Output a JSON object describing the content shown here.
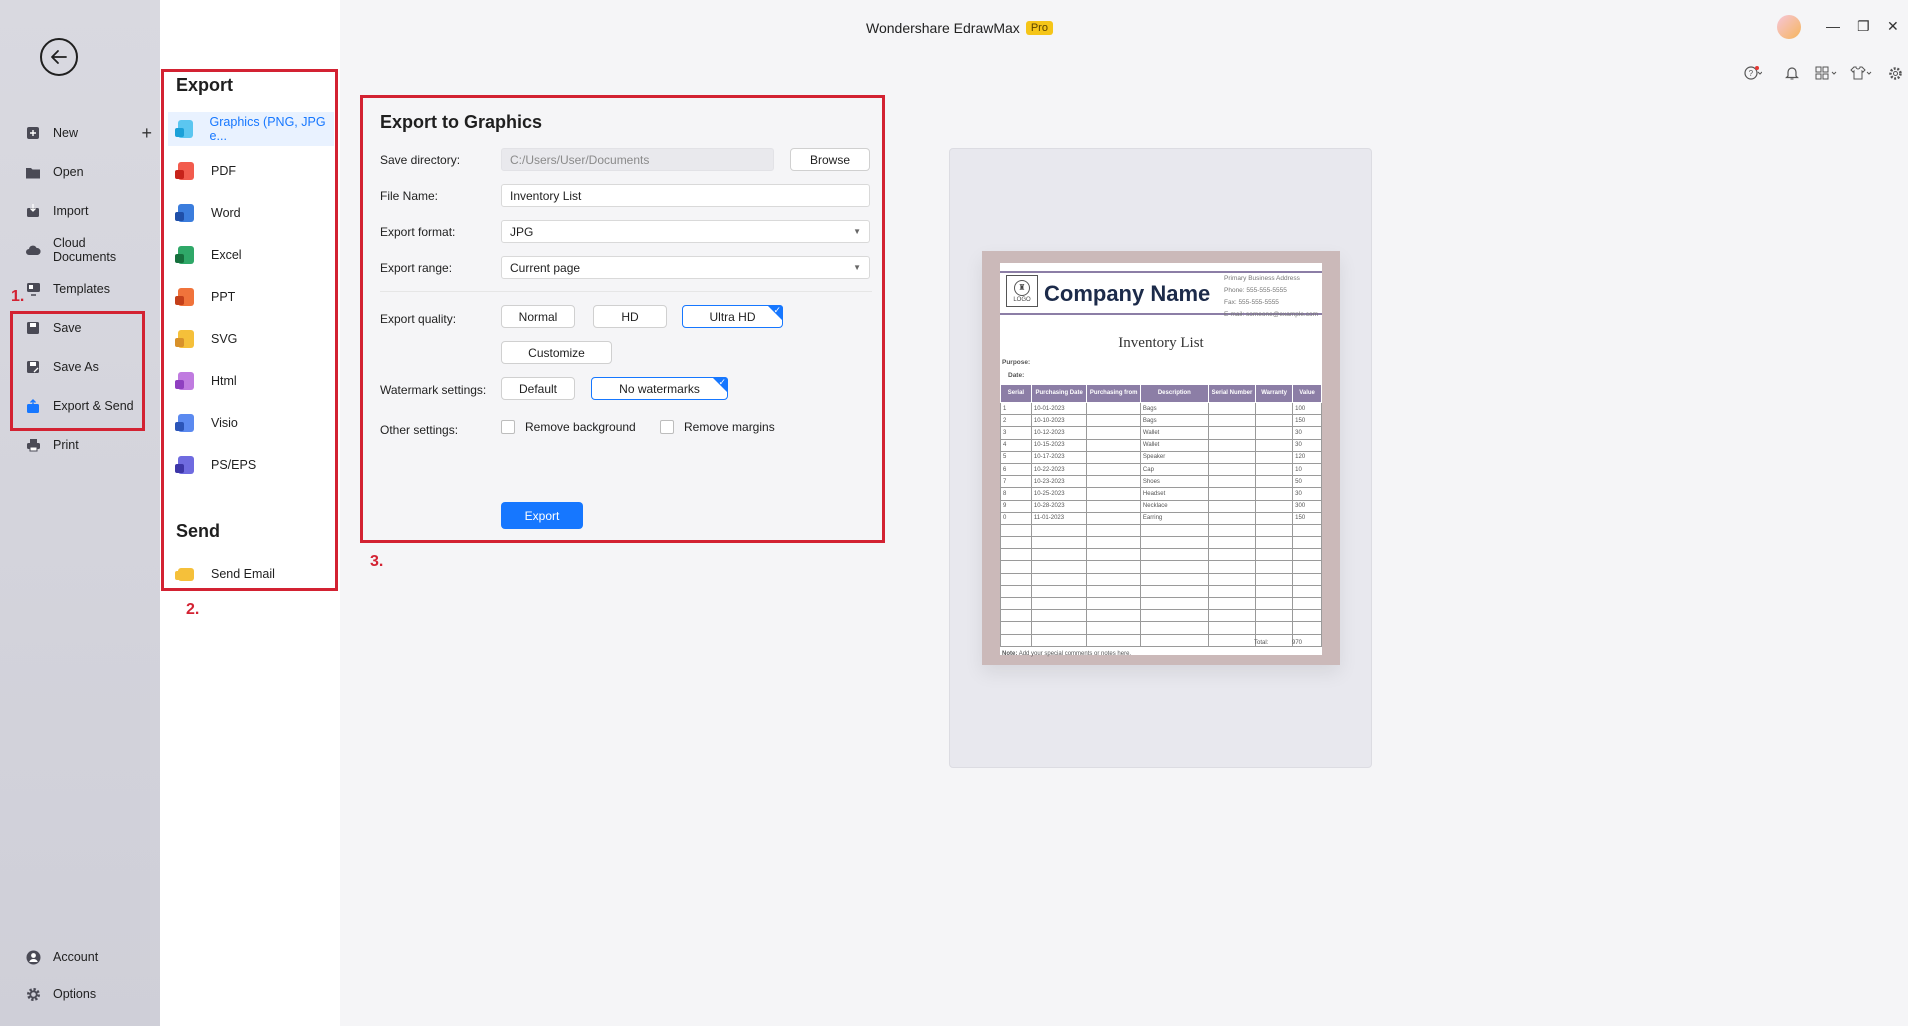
{
  "app": {
    "title": "Wondershare EdrawMax",
    "badge": "Pro"
  },
  "nav": {
    "items": [
      {
        "label": "New",
        "icon": "plus-square-icon",
        "has_plus": true
      },
      {
        "label": "Open",
        "icon": "folder-icon"
      },
      {
        "label": "Import",
        "icon": "import-icon"
      },
      {
        "label": "Cloud Documents",
        "icon": "cloud-icon"
      },
      {
        "label": "Templates",
        "icon": "templates-icon"
      },
      {
        "label": "Save",
        "icon": "save-icon"
      },
      {
        "label": "Save As",
        "icon": "save-as-icon"
      },
      {
        "label": "Export & Send",
        "icon": "export-icon",
        "active": true
      },
      {
        "label": "Print",
        "icon": "print-icon"
      }
    ],
    "bottom": [
      {
        "label": "Account",
        "icon": "account-icon"
      },
      {
        "label": "Options",
        "icon": "gear-icon"
      }
    ]
  },
  "export_list": {
    "heading": "Export",
    "items": [
      {
        "label": "Graphics (PNG, JPG e...",
        "color": "#5bc6f0",
        "badge": "#1aa0d8",
        "selected": true
      },
      {
        "label": "PDF",
        "color": "#f25b4d",
        "badge": "#c7231a"
      },
      {
        "label": "Word",
        "color": "#3b7ddd",
        "badge": "#1f4fa8"
      },
      {
        "label": "Excel",
        "color": "#2fa868",
        "badge": "#16703d"
      },
      {
        "label": "PPT",
        "color": "#f0733b",
        "badge": "#c4401a"
      },
      {
        "label": "SVG",
        "color": "#f5c03a",
        "badge": "#d8912a"
      },
      {
        "label": "Html",
        "color": "#c07be0",
        "badge": "#8f3fc0"
      },
      {
        "label": "Visio",
        "color": "#5b8af0",
        "badge": "#2b55b8"
      },
      {
        "label": "PS/EPS",
        "color": "#6f6be0",
        "badge": "#3d36a8"
      }
    ],
    "send_heading": "Send",
    "send_items": [
      {
        "label": "Send Email",
        "color": "#f5c03a"
      }
    ]
  },
  "dialog": {
    "title": "Export to Graphics",
    "save_directory_label": "Save directory:",
    "save_directory_value": "C:/Users/User/Documents",
    "browse_label": "Browse",
    "file_name_label": "File Name:",
    "file_name_value": "Inventory List",
    "export_format_label": "Export format:",
    "export_format_value": "JPG",
    "export_range_label": "Export range:",
    "export_range_value": "Current page",
    "quality_label": "Export quality:",
    "quality_options": [
      "Normal",
      "HD",
      "Ultra HD"
    ],
    "quality_selected": "Ultra HD",
    "customize_label": "Customize",
    "watermark_label": "Watermark settings:",
    "watermark_options": [
      "Default",
      "No watermarks"
    ],
    "watermark_selected": "No watermarks",
    "other_label": "Other settings:",
    "remove_background_label": "Remove background",
    "remove_margins_label": "Remove margins",
    "export_button": "Export"
  },
  "annotations": {
    "one": "1.",
    "two": "2.",
    "three": "3."
  },
  "preview": {
    "logo": "LOGO",
    "company": "Company Name",
    "contact": [
      "Primary Business Address",
      "Phone: 555-555-5555",
      "Fax: 555-555-5555",
      "E-mail: someone@example.com"
    ],
    "title": "Inventory List",
    "purpose_label": "Purpose:",
    "date_label": "Date:",
    "columns": [
      "Serial",
      "Purchasing Date",
      "Purchasing from",
      "Description",
      "Serial Number",
      "Warranty",
      "Value"
    ],
    "rows": [
      [
        "1",
        "10-01-2023",
        "",
        "Bags",
        "",
        "",
        "100"
      ],
      [
        "2",
        "10-10-2023",
        "",
        "Bags",
        "",
        "",
        "150"
      ],
      [
        "3",
        "10-12-2023",
        "",
        "Wallet",
        "",
        "",
        "30"
      ],
      [
        "4",
        "10-15-2023",
        "",
        "Wallet",
        "",
        "",
        "30"
      ],
      [
        "5",
        "10-17-2023",
        "",
        "Speaker",
        "",
        "",
        "120"
      ],
      [
        "6",
        "10-22-2023",
        "",
        "Cap",
        "",
        "",
        "10"
      ],
      [
        "7",
        "10-23-2023",
        "",
        "Shoes",
        "",
        "",
        "50"
      ],
      [
        "8",
        "10-25-2023",
        "",
        "Headset",
        "",
        "",
        "30"
      ],
      [
        "9",
        "10-28-2023",
        "",
        "Necklace",
        "",
        "",
        "300"
      ],
      [
        "0",
        "11-01-2023",
        "",
        "Earring",
        "",
        "",
        "150"
      ]
    ],
    "empty_rows": 10,
    "total_label": "Total:",
    "total_value": "970",
    "note_label": "Note:",
    "note_text": "Add your special comments or notes here."
  }
}
